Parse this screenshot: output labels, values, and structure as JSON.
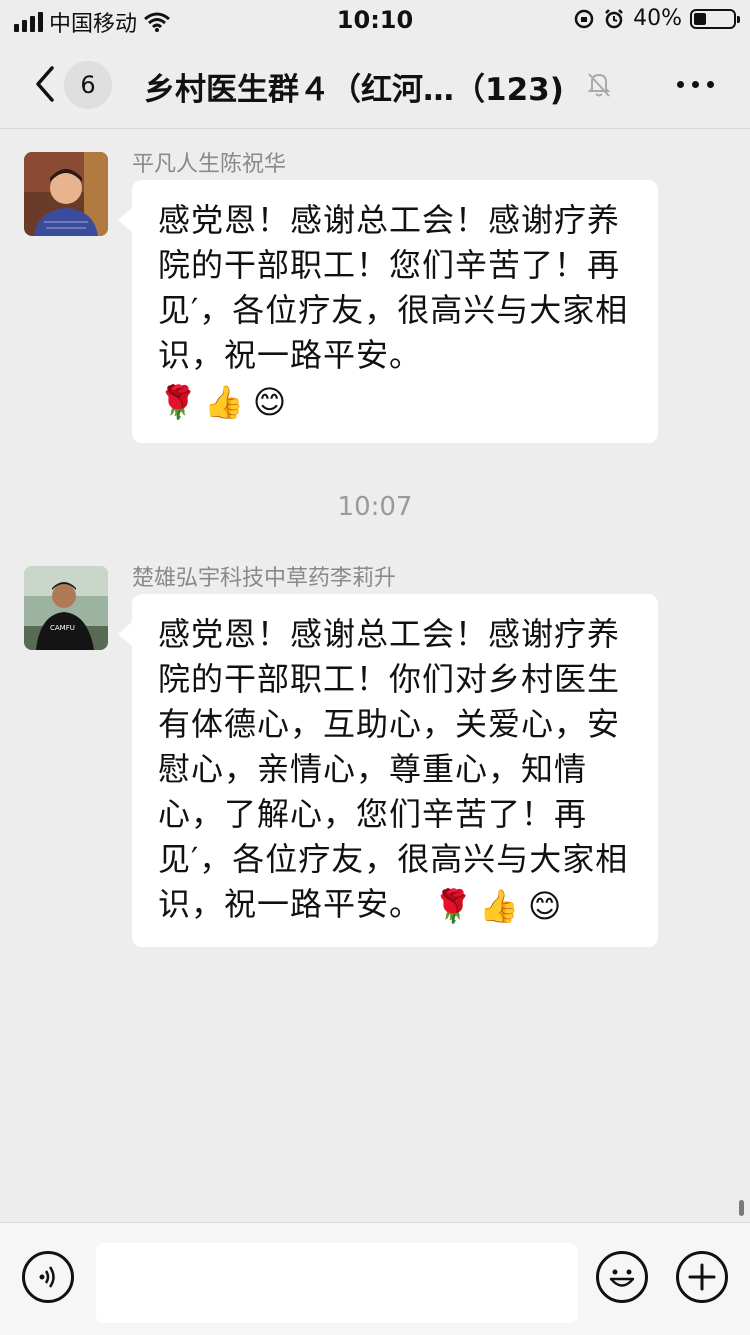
{
  "status_bar": {
    "carrier": "中国移动",
    "time": "10:10",
    "battery": "40%"
  },
  "nav": {
    "unread_count": "6",
    "title": "乡村医生群４（红河…（123)"
  },
  "messages": [
    {
      "sender": "平凡人生陈祝华",
      "text": "感党恩！感谢总工会！感谢疗养院的干部职工！您们辛苦了！再见′，各位疗友，很高兴与大家相识，祝一路平安。",
      "emojis": [
        "rose",
        "thumbs-up",
        "smile"
      ]
    },
    {
      "sender": "楚雄弘宇科技中草药李莉升",
      "text": "感党恩！感谢总工会！感谢疗养院的干部职工！你们对乡村医生有体德心，互助心，关爱心，安慰心，亲情心，尊重心，知情心，了解心，您们辛苦了！再见′，各位疗友，很高兴与大家相识，祝一路平安。",
      "emojis": [
        "rose",
        "thumbs-up",
        "smile"
      ]
    }
  ],
  "timestamp": "10:07",
  "input": {
    "value": "",
    "placeholder": ""
  },
  "colors": {
    "background": "#ededed",
    "bubble": "#ffffff",
    "secondary_text": "#8a8a8a"
  }
}
